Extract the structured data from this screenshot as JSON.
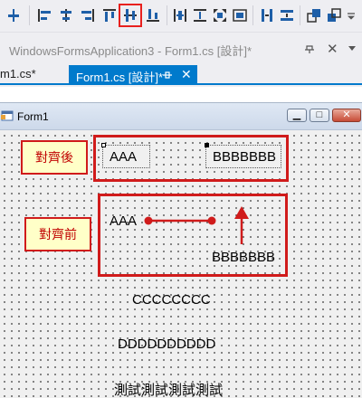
{
  "toolbar": {
    "items": [
      {
        "name": "align-to-grid-icon"
      },
      {
        "name": "align-lefts-icon"
      },
      {
        "name": "align-centers-icon"
      },
      {
        "name": "align-rights-icon"
      },
      {
        "name": "align-tops-icon"
      },
      {
        "name": "align-middles-icon",
        "highlighted": true
      },
      {
        "name": "align-bottoms-icon"
      },
      {
        "name": "make-same-width-icon"
      },
      {
        "name": "make-same-height-icon"
      },
      {
        "name": "size-to-grid-icon"
      },
      {
        "name": "make-same-size-icon"
      },
      {
        "name": "horizontal-spacing-icon"
      },
      {
        "name": "vertical-spacing-icon"
      },
      {
        "name": "bring-to-front-icon"
      },
      {
        "name": "send-to-back-icon"
      },
      {
        "name": "toolbar-overflow-icon"
      }
    ],
    "highlight_color": "#e8201e"
  },
  "document": {
    "title": "WindowsFormsApplication3 - Form1.cs [設計]*"
  },
  "tabs": [
    {
      "label": "m1.cs*",
      "active": false
    },
    {
      "label": "Form1.cs [設計]*",
      "active": true
    }
  ],
  "accent_color": "#007acc",
  "form": {
    "title": "Form1",
    "annotations": {
      "after_tag": "對齊後",
      "before_tag": "對齊前",
      "color": "#d01b1b"
    },
    "after_labels": {
      "a": "AAA",
      "b": "BBBBBBB"
    },
    "before_labels": {
      "a": "AAA",
      "b": "BBBBBBB"
    },
    "labels": [
      "CCCCCCCC",
      "DDDDDDDDDD",
      "測試測試測試測試"
    ]
  }
}
